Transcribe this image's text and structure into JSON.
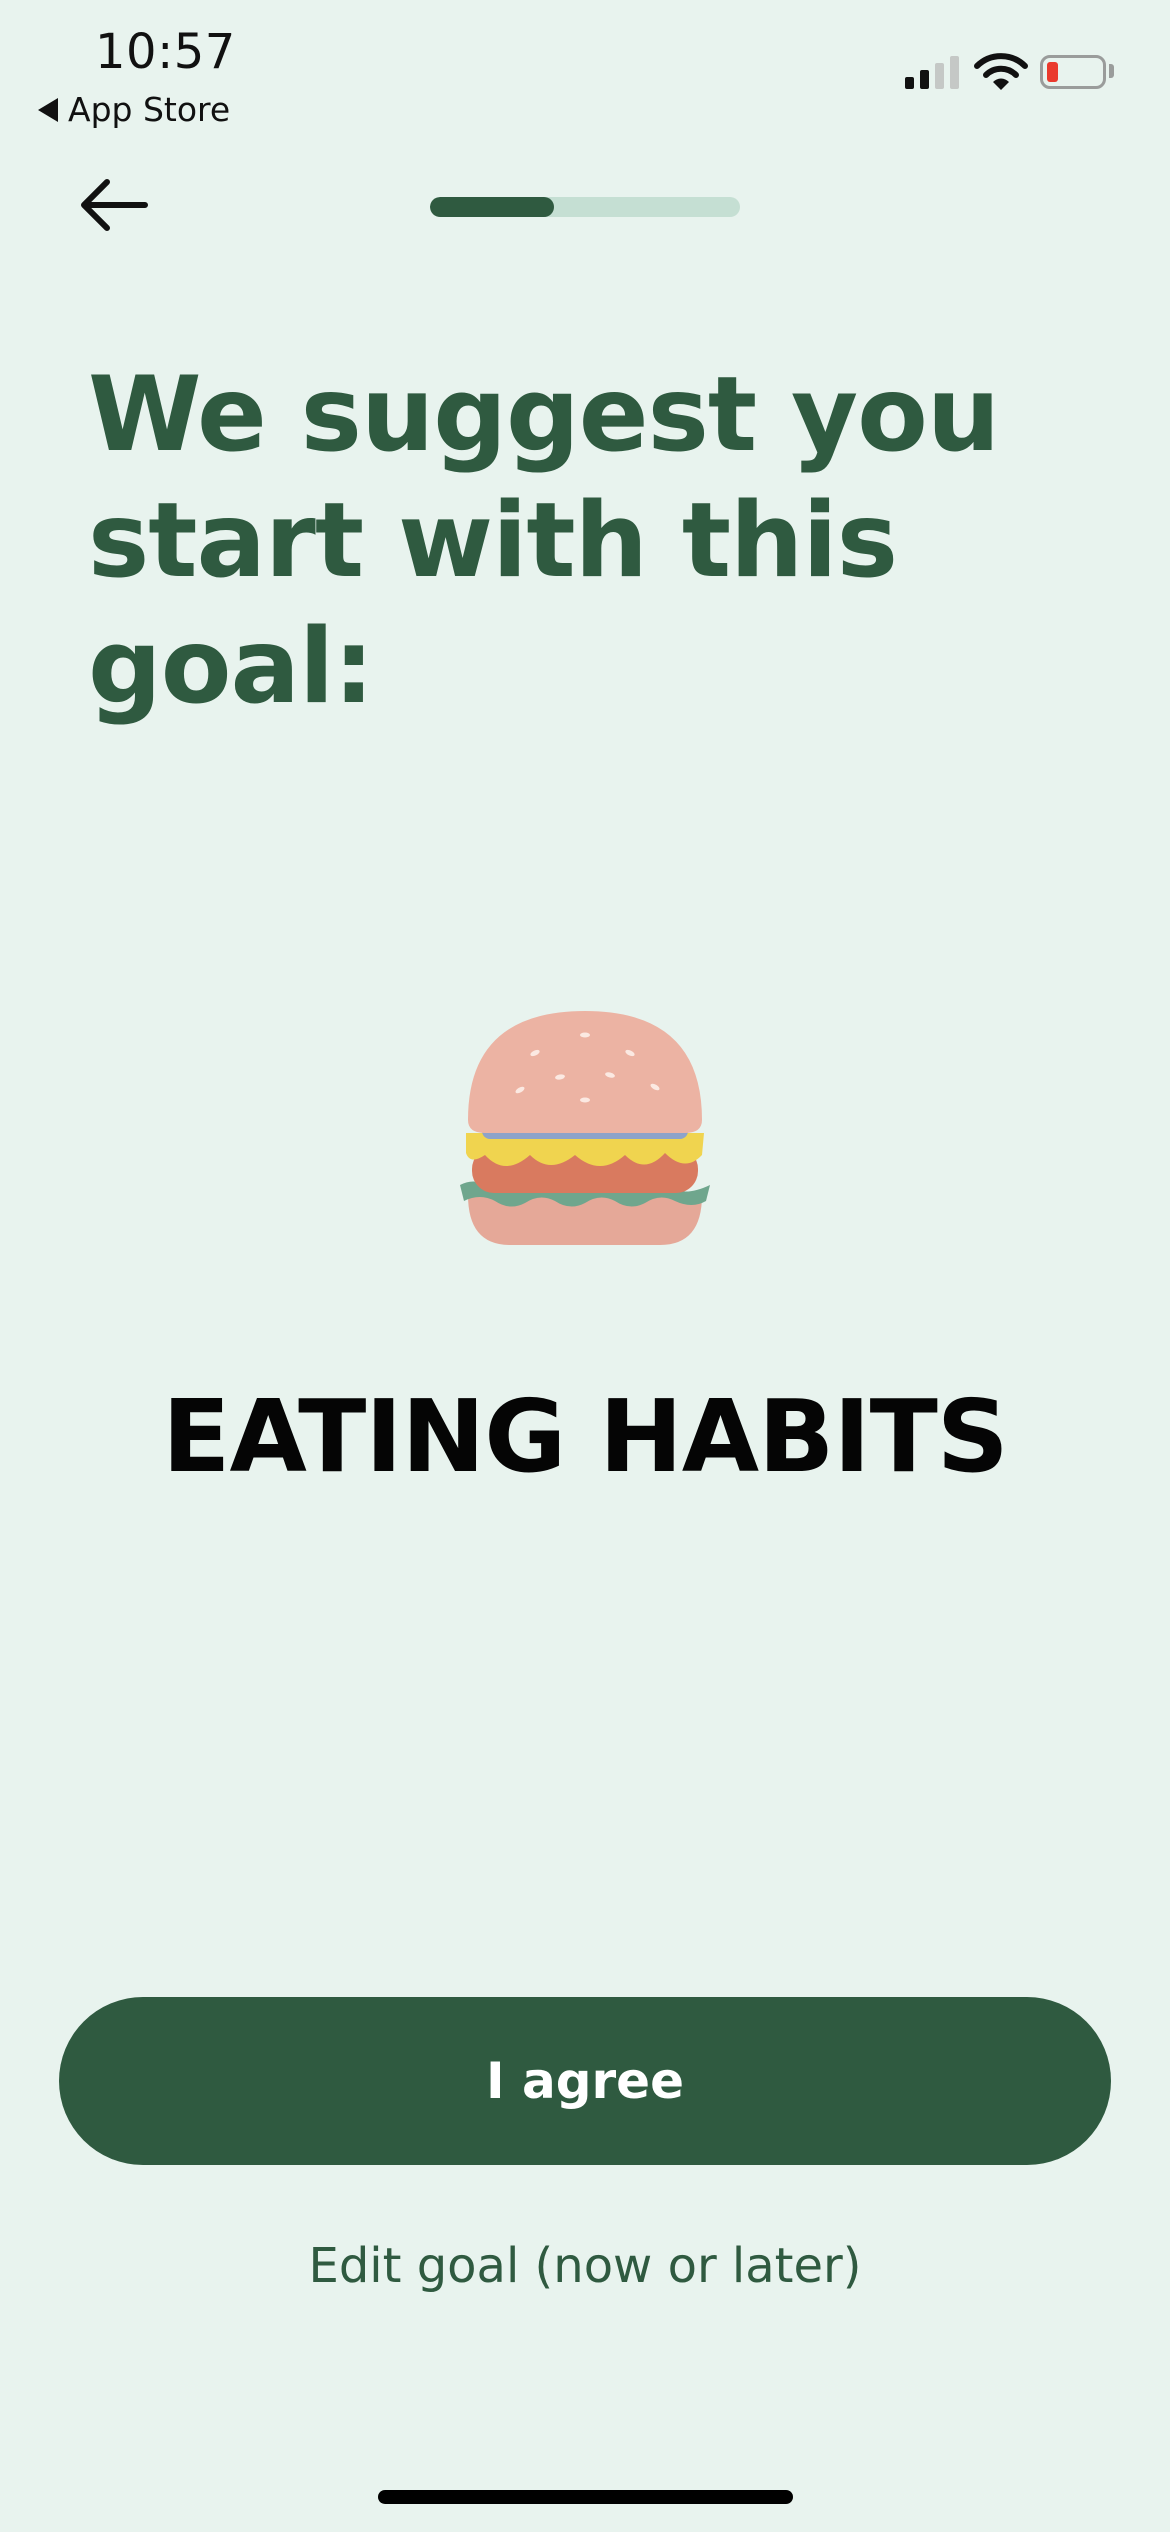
{
  "status_bar": {
    "time": "10:57",
    "back_app_label": "App Store",
    "signal_bars_active": 2,
    "signal_bars_total": 4,
    "battery_level": 0.12
  },
  "nav": {
    "back_icon": "arrow-left-icon",
    "progress": 0.4
  },
  "headline": {
    "line1": "We suggest you",
    "line2": "start with this goal:"
  },
  "goal": {
    "icon": "burger-icon",
    "name": "EATING HABITS"
  },
  "actions": {
    "agree_label": "I agree",
    "edit_label": "Edit goal (now or later)"
  },
  "colors": {
    "background": "#e8f3ee",
    "accent": "#2f5a40",
    "progress_track": "#c5dfd3",
    "battery_low": "#ea3a2d"
  }
}
